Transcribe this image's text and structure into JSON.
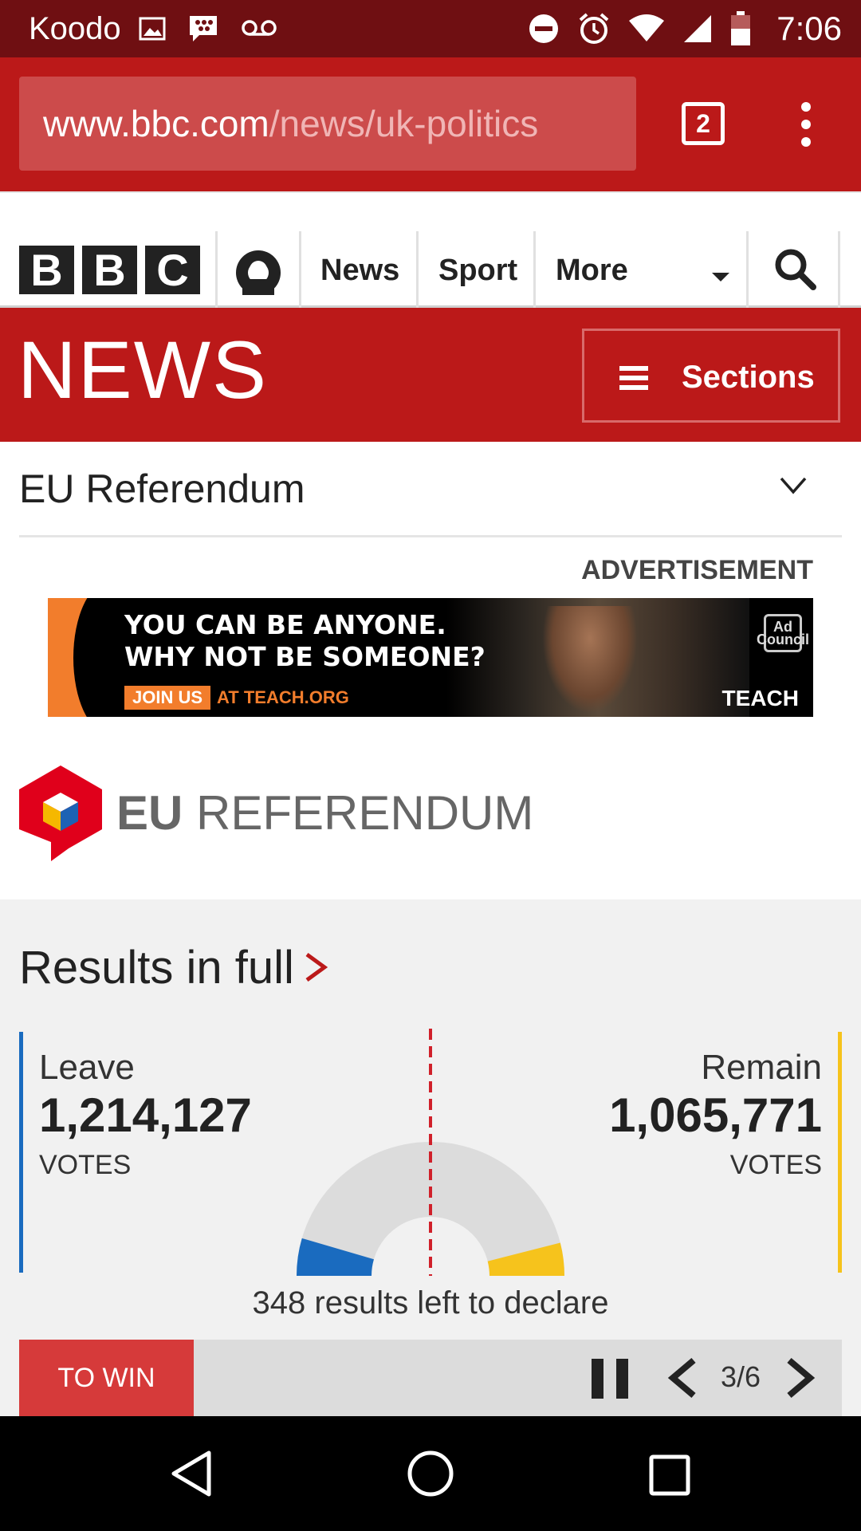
{
  "status_bar": {
    "carrier": "Koodo",
    "time": "7:06"
  },
  "browser": {
    "url_host": "www.bbc.com",
    "url_path": "/news/uk-politics",
    "tab_count": "2"
  },
  "bbc_nav": {
    "logo_letters": [
      "B",
      "B",
      "C"
    ],
    "items": [
      {
        "label": "News"
      },
      {
        "label": "Sport"
      },
      {
        "label": "More"
      }
    ]
  },
  "news_banner": {
    "title": "NEWS",
    "sections_label": "Sections"
  },
  "topic": {
    "label": "EU Referendum"
  },
  "advertisement": {
    "label": "ADVERTISEMENT",
    "headline_line1": "YOU CAN BE ANYONE.",
    "headline_line2": "WHY NOT BE SOMEONE?",
    "cta_button": "JOIN US",
    "cta_site": "AT TEACH.ORG",
    "council_badge": "Ad Council",
    "brand": "TEACH"
  },
  "eu_brand": {
    "title_bold": "EU",
    "title_light": " REFERENDUM"
  },
  "results": {
    "heading": "Results in full",
    "leave": {
      "name": "Leave",
      "votes": "1,214,127",
      "unit": "VOTES",
      "color": "#1a6bbf",
      "share": 0.5325
    },
    "remain": {
      "name": "Remain",
      "votes": "1,065,771",
      "unit": "VOTES",
      "color": "#f6c31c",
      "share": 0.4675
    },
    "results_left": "348 results left to declare",
    "to_win_label": "TO WIN",
    "page_indicator": "3/6"
  },
  "colors": {
    "bbc_red": "#bb1919",
    "status_bar": "#6f0f12",
    "leave_blue": "#1a6bbf",
    "remain_yellow": "#f6c31c"
  }
}
